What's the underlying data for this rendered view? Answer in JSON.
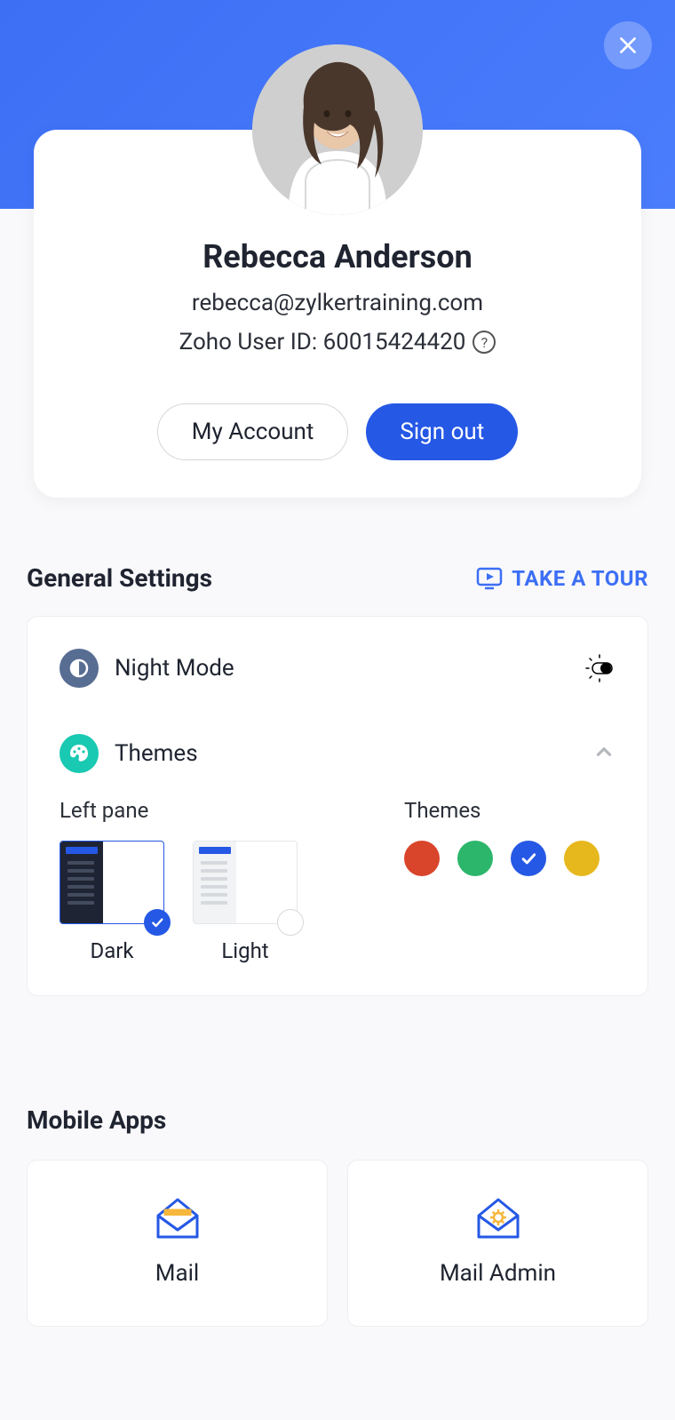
{
  "user": {
    "name": "Rebecca Anderson",
    "email": "rebecca@zylkertraining.com",
    "id_label": "Zoho User ID: 60015424420"
  },
  "buttons": {
    "my_account": "My Account",
    "sign_out": "Sign out"
  },
  "general": {
    "title": "General Settings",
    "tour": "TAKE A TOUR",
    "night_mode": "Night Mode",
    "themes_label": "Themes",
    "left_pane_label": "Left pane",
    "themes_sub_label": "Themes",
    "pane_dark": "Dark",
    "pane_light": "Light",
    "theme_colors": [
      {
        "name": "red",
        "hex": "#d9452b",
        "selected": false
      },
      {
        "name": "green",
        "hex": "#2cb66b",
        "selected": false
      },
      {
        "name": "blue",
        "hex": "#2558e5",
        "selected": true
      },
      {
        "name": "yellow",
        "hex": "#e7b81d",
        "selected": false
      }
    ]
  },
  "mobile": {
    "title": "Mobile Apps",
    "apps": [
      {
        "name": "Mail"
      },
      {
        "name": "Mail Admin"
      }
    ]
  }
}
